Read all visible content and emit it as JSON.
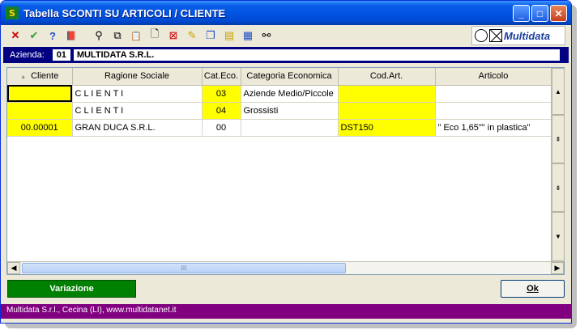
{
  "window": {
    "title": "Tabella SCONTI SU ARTICOLI / CLIENTE"
  },
  "title_buttons": {
    "minimize": "_",
    "maximize": "□",
    "close": "✕"
  },
  "toolbar": {
    "tools": [
      {
        "icon": "delete-icon",
        "glyph": "✕",
        "color": "#d00000"
      },
      {
        "icon": "confirm-icon",
        "glyph": "✔",
        "color": "#2e9e2e"
      },
      {
        "icon": "help-icon",
        "glyph": "?",
        "color": "#1f4fc8"
      },
      {
        "icon": "book-icon",
        "glyph": "📕",
        "color": "#800000"
      },
      {
        "icon": "binoculars-icon",
        "glyph": "⚲",
        "color": "#000000"
      },
      {
        "icon": "copy-icon",
        "glyph": "⧉",
        "color": "#000000"
      },
      {
        "icon": "paste-icon",
        "glyph": "📋",
        "color": "#808080"
      },
      {
        "icon": "new-page-icon",
        "glyph": "🗋",
        "color": "#000000"
      },
      {
        "icon": "delete-row-icon",
        "glyph": "⊠",
        "color": "#d00000"
      },
      {
        "icon": "edit-icon",
        "glyph": "✎",
        "color": "#c8a000"
      },
      {
        "icon": "window-icon",
        "glyph": "❐",
        "color": "#1f4fc8"
      },
      {
        "icon": "folder-icon",
        "glyph": "▤",
        "color": "#c8a000"
      },
      {
        "icon": "form-icon",
        "glyph": "▦",
        "color": "#1f4fc8"
      },
      {
        "icon": "find-icon",
        "glyph": "⚯",
        "color": "#000000"
      }
    ],
    "logo_text": "Multidata"
  },
  "azienda": {
    "label": "Azienda:",
    "code": "01",
    "name": "MULTIDATA S.R.L."
  },
  "grid": {
    "sort_indicator": "▲",
    "columns": [
      "Cliente",
      "Ragione Sociale",
      "Cat.Eco.",
      "Categoria Economica",
      "Cod.Art.",
      "Articolo"
    ],
    "rows": [
      {
        "cliente": "",
        "ragione": "C L I E N T I",
        "cat": "03",
        "categoria": "Aziende Medio/Piccole",
        "codart": "",
        "articolo": ""
      },
      {
        "cliente": "",
        "ragione": "C L I E N T I",
        "cat": "04",
        "categoria": "Grossisti",
        "codart": "",
        "articolo": ""
      },
      {
        "cliente": "00.00001",
        "ragione": "GRAN DUCA S.R.L.",
        "cat": "00",
        "categoria": "",
        "codart": "DST150",
        "articolo": "\" Eco 1,65\"\" in plastica\""
      }
    ],
    "scroll_thumb_text": "III"
  },
  "buttons": {
    "variazione": "Variazione",
    "ok": "Ok"
  },
  "status": {
    "text": "Multidata S.r.l., Cecina (LI), www.multidatanet.it"
  },
  "colors": {
    "title_bar": "#0054e3",
    "highlight": "#ffff00",
    "azienda_bar": "#000080",
    "variazione": "#008000",
    "status_bar": "#800080"
  }
}
